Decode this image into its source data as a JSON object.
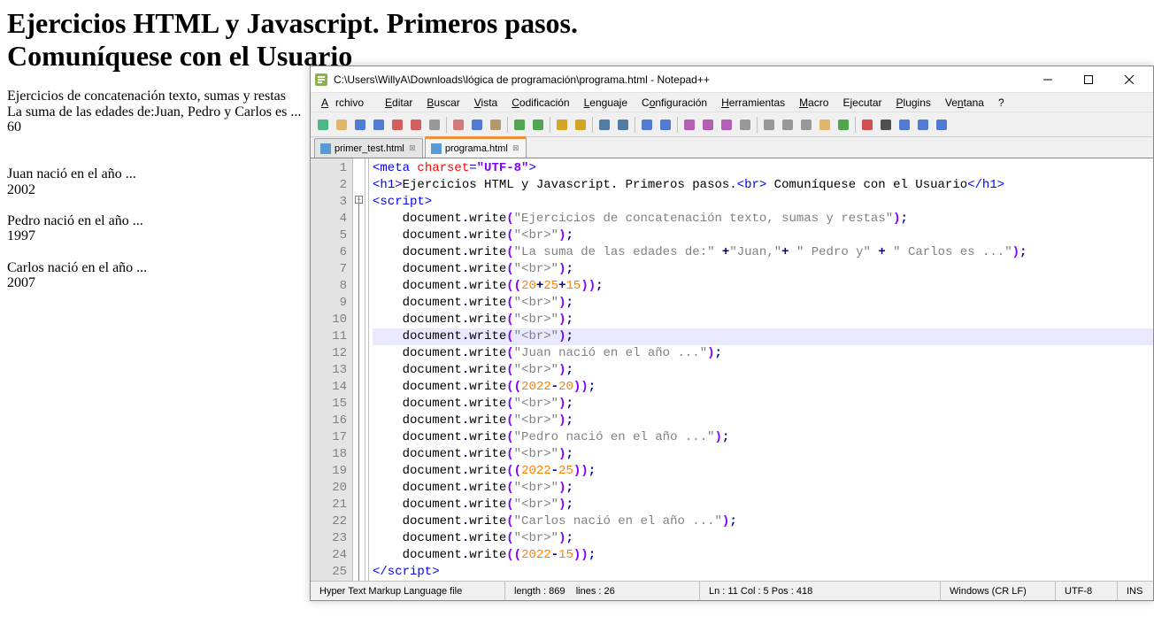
{
  "background": {
    "h1_line1": "Ejercicios HTML y Javascript. Primeros pasos.",
    "h1_line2": "Comuníquese con el Usuario",
    "line1": "Ejercicios de concatenación texto, sumas y restas",
    "line2": "La suma de las edades de:Juan, Pedro y Carlos es ...",
    "line3": "60",
    "juan_l": "Juan nació en el año ...",
    "juan_y": "2002",
    "pedro_l": "Pedro nació en el año ...",
    "pedro_y": "1997",
    "carlos_l": "Carlos nació en el año ...",
    "carlos_y": "2007"
  },
  "window": {
    "title": "C:\\Users\\WillyA\\Downloads\\lógica de programación\\programa.html - Notepad++"
  },
  "menu": {
    "archivo": "Archivo",
    "editar": "Editar",
    "buscar": "Buscar",
    "vista": "Vista",
    "codificacion": "Codificación",
    "lenguaje": "Lenguaje",
    "configuracion": "Configuración",
    "herramientas": "Herramientas",
    "macro": "Macro",
    "ejecutar": "Ejecutar",
    "plugins": "Plugins",
    "ventana": "Ventana",
    "help": "?"
  },
  "tabs": {
    "t1": "primer_test.html",
    "t2": "programa.html"
  },
  "code": {
    "lines": [
      {
        "n": "1",
        "html": "<span class='k-tag'>&lt;meta</span> <span class='k-attr'>charset</span><span class='k-tag'>=</span><span class='k-str'>\"UTF-8\"</span><span class='k-tag'>&gt;</span>"
      },
      {
        "n": "2",
        "html": "<span class='k-tag'>&lt;h1&gt;</span><span class='k-txt'>Ejercicios HTML y Javascript. Primeros pasos.</span><span class='k-tag'>&lt;br&gt;</span><span class='k-txt'> Comuníquese con el Usuario</span><span class='k-tag'>&lt;/h1&gt;</span>"
      },
      {
        "n": "3",
        "html": "<span class='k-tag'>&lt;script&gt;</span>"
      },
      {
        "n": "4",
        "html": "    <span class='k-id'>document</span><span class='k-op'>.</span><span class='k-id'>write</span><span class='k-paren'>(</span><span class='k-gray'>\"Ejercicios de concatenación texto, sumas y restas\"</span><span class='k-paren'>)</span><span class='k-op'>;</span>"
      },
      {
        "n": "5",
        "html": "    <span class='k-id'>document</span><span class='k-op'>.</span><span class='k-id'>write</span><span class='k-paren'>(</span><span class='k-gray'>\"&lt;br&gt;\"</span><span class='k-paren'>)</span><span class='k-op'>;</span>"
      },
      {
        "n": "6",
        "html": "    <span class='k-id'>document</span><span class='k-op'>.</span><span class='k-id'>write</span><span class='k-paren'>(</span><span class='k-gray'>\"La suma de las edades de:\"</span> <span class='k-op'>+</span><span class='k-gray'>\"Juan,\"</span><span class='k-op'>+</span> <span class='k-gray'>\" Pedro y\"</span> <span class='k-op'>+</span> <span class='k-gray'>\" Carlos es ...\"</span><span class='k-paren'>)</span><span class='k-op'>;</span>"
      },
      {
        "n": "7",
        "html": "    <span class='k-id'>document</span><span class='k-op'>.</span><span class='k-id'>write</span><span class='k-paren'>(</span><span class='k-gray'>\"&lt;br&gt;\"</span><span class='k-paren'>)</span><span class='k-op'>;</span>"
      },
      {
        "n": "8",
        "html": "    <span class='k-id'>document</span><span class='k-op'>.</span><span class='k-id'>write</span><span class='k-paren'>((</span><span class='k-num'>20</span><span class='k-op'>+</span><span class='k-num'>25</span><span class='k-op'>+</span><span class='k-num'>15</span><span class='k-paren'>))</span><span class='k-op'>;</span>"
      },
      {
        "n": "9",
        "html": "    <span class='k-id'>document</span><span class='k-op'>.</span><span class='k-id'>write</span><span class='k-paren'>(</span><span class='k-gray'>\"&lt;br&gt;\"</span><span class='k-paren'>)</span><span class='k-op'>;</span>"
      },
      {
        "n": "10",
        "html": "    <span class='k-id'>document</span><span class='k-op'>.</span><span class='k-id'>write</span><span class='k-paren'>(</span><span class='k-gray'>\"&lt;br&gt;\"</span><span class='k-paren'>)</span><span class='k-op'>;</span>"
      },
      {
        "n": "11",
        "hl": true,
        "html": "    <span class='k-id'>document</span><span class='k-op'>.</span><span class='k-id'>write</span><span class='k-paren'>(</span><span class='k-gray'>\"&lt;br&gt;\"</span><span class='k-paren'>)</span><span class='k-op'>;</span>"
      },
      {
        "n": "12",
        "html": "    <span class='k-id'>document</span><span class='k-op'>.</span><span class='k-id'>write</span><span class='k-paren'>(</span><span class='k-gray'>\"Juan nació en el año ...\"</span><span class='k-paren'>)</span><span class='k-op'>;</span>"
      },
      {
        "n": "13",
        "html": "    <span class='k-id'>document</span><span class='k-op'>.</span><span class='k-id'>write</span><span class='k-paren'>(</span><span class='k-gray'>\"&lt;br&gt;\"</span><span class='k-paren'>)</span><span class='k-op'>;</span>"
      },
      {
        "n": "14",
        "html": "    <span class='k-id'>document</span><span class='k-op'>.</span><span class='k-id'>write</span><span class='k-paren'>((</span><span class='k-num'>2022</span><span class='k-op'>-</span><span class='k-num'>20</span><span class='k-paren'>))</span><span class='k-op'>;</span>"
      },
      {
        "n": "15",
        "html": "    <span class='k-id'>document</span><span class='k-op'>.</span><span class='k-id'>write</span><span class='k-paren'>(</span><span class='k-gray'>\"&lt;br&gt;\"</span><span class='k-paren'>)</span><span class='k-op'>;</span>"
      },
      {
        "n": "16",
        "html": "    <span class='k-id'>document</span><span class='k-op'>.</span><span class='k-id'>write</span><span class='k-paren'>(</span><span class='k-gray'>\"&lt;br&gt;\"</span><span class='k-paren'>)</span><span class='k-op'>;</span>"
      },
      {
        "n": "17",
        "html": "    <span class='k-id'>document</span><span class='k-op'>.</span><span class='k-id'>write</span><span class='k-paren'>(</span><span class='k-gray'>\"Pedro nació en el año ...\"</span><span class='k-paren'>)</span><span class='k-op'>;</span>"
      },
      {
        "n": "18",
        "html": "    <span class='k-id'>document</span><span class='k-op'>.</span><span class='k-id'>write</span><span class='k-paren'>(</span><span class='k-gray'>\"&lt;br&gt;\"</span><span class='k-paren'>)</span><span class='k-op'>;</span>"
      },
      {
        "n": "19",
        "html": "    <span class='k-id'>document</span><span class='k-op'>.</span><span class='k-id'>write</span><span class='k-paren'>((</span><span class='k-num'>2022</span><span class='k-op'>-</span><span class='k-num'>25</span><span class='k-paren'>))</span><span class='k-op'>;</span>"
      },
      {
        "n": "20",
        "html": "    <span class='k-id'>document</span><span class='k-op'>.</span><span class='k-id'>write</span><span class='k-paren'>(</span><span class='k-gray'>\"&lt;br&gt;\"</span><span class='k-paren'>)</span><span class='k-op'>;</span>"
      },
      {
        "n": "21",
        "html": "    <span class='k-id'>document</span><span class='k-op'>.</span><span class='k-id'>write</span><span class='k-paren'>(</span><span class='k-gray'>\"&lt;br&gt;\"</span><span class='k-paren'>)</span><span class='k-op'>;</span>"
      },
      {
        "n": "22",
        "html": "    <span class='k-id'>document</span><span class='k-op'>.</span><span class='k-id'>write</span><span class='k-paren'>(</span><span class='k-gray'>\"Carlos nació en el año ...\"</span><span class='k-paren'>)</span><span class='k-op'>;</span>"
      },
      {
        "n": "23",
        "html": "    <span class='k-id'>document</span><span class='k-op'>.</span><span class='k-id'>write</span><span class='k-paren'>(</span><span class='k-gray'>\"&lt;br&gt;\"</span><span class='k-paren'>)</span><span class='k-op'>;</span>"
      },
      {
        "n": "24",
        "html": "    <span class='k-id'>document</span><span class='k-op'>.</span><span class='k-id'>write</span><span class='k-paren'>((</span><span class='k-num'>2022</span><span class='k-op'>-</span><span class='k-num'>15</span><span class='k-paren'>))</span><span class='k-op'>;</span>"
      },
      {
        "n": "25",
        "html": "<span class='k-tag'>&lt;/script&gt;</span>"
      }
    ]
  },
  "status": {
    "lang": "Hyper Text Markup Language file",
    "length": "length : 869",
    "lines": "lines : 26",
    "pos": "Ln : 11    Col : 5    Pos : 418",
    "eol": "Windows (CR LF)",
    "enc": "UTF-8",
    "ins": "INS"
  },
  "toolbar_icons": [
    {
      "name": "new-file-icon",
      "color": "#3a7"
    },
    {
      "name": "open-file-icon",
      "color": "#da5"
    },
    {
      "name": "save-icon",
      "color": "#36c"
    },
    {
      "name": "save-all-icon",
      "color": "#36c"
    },
    {
      "name": "close-icon",
      "color": "#c44"
    },
    {
      "name": "close-all-icon",
      "color": "#c44"
    },
    {
      "name": "print-icon",
      "color": "#888"
    },
    {
      "sep": true
    },
    {
      "name": "cut-icon",
      "color": "#c66"
    },
    {
      "name": "copy-icon",
      "color": "#36c"
    },
    {
      "name": "paste-icon",
      "color": "#a85"
    },
    {
      "sep": true
    },
    {
      "name": "undo-icon",
      "color": "#393"
    },
    {
      "name": "redo-icon",
      "color": "#393"
    },
    {
      "sep": true
    },
    {
      "name": "find-icon",
      "color": "#c90"
    },
    {
      "name": "replace-icon",
      "color": "#c90"
    },
    {
      "sep": true
    },
    {
      "name": "zoom-in-icon",
      "color": "#369"
    },
    {
      "name": "zoom-out-icon",
      "color": "#369"
    },
    {
      "sep": true
    },
    {
      "name": "sync-scroll-v-icon",
      "color": "#36c"
    },
    {
      "name": "sync-scroll-h-icon",
      "color": "#36c"
    },
    {
      "sep": true
    },
    {
      "name": "word-wrap-icon",
      "color": "#a4a"
    },
    {
      "name": "all-chars-icon",
      "color": "#a4a"
    },
    {
      "name": "indent-guide-icon",
      "color": "#a4a"
    },
    {
      "name": "lang-icon",
      "color": "#888"
    },
    {
      "sep": true
    },
    {
      "name": "doc-map-icon",
      "color": "#888"
    },
    {
      "name": "doc-list-icon",
      "color": "#888"
    },
    {
      "name": "func-list-icon",
      "color": "#888"
    },
    {
      "name": "folder-tree-icon",
      "color": "#da5"
    },
    {
      "name": "monitor-icon",
      "color": "#393"
    },
    {
      "sep": true
    },
    {
      "name": "record-icon",
      "color": "#c33"
    },
    {
      "name": "stop-icon",
      "color": "#333"
    },
    {
      "name": "play-icon",
      "color": "#36c"
    },
    {
      "name": "play-multi-icon",
      "color": "#36c"
    },
    {
      "name": "save-macro-icon",
      "color": "#36c"
    }
  ]
}
